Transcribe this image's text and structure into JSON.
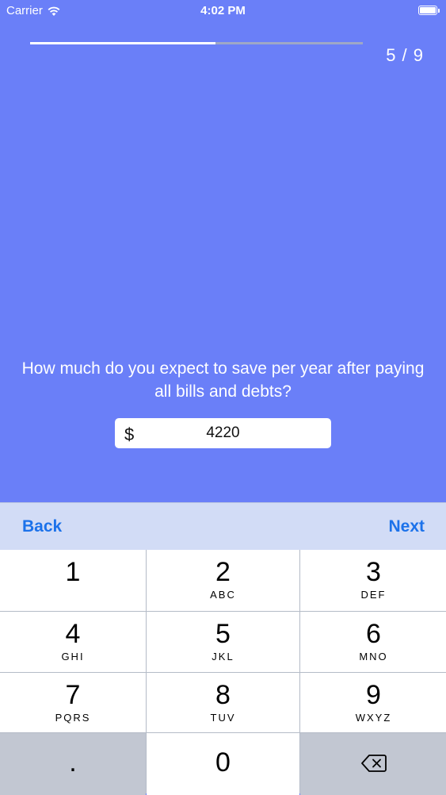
{
  "status_bar": {
    "carrier": "Carrier",
    "time": "4:02 PM",
    "wifi_icon": "wifi-icon",
    "battery_icon": "battery-icon"
  },
  "progress": {
    "current": 5,
    "total": 9,
    "label": "5 / 9",
    "fill_fraction": 0.556
  },
  "question": {
    "text": "How much do you expect to save per year after paying all bills and debts?"
  },
  "amount_field": {
    "currency_symbol": "$",
    "value": "4220"
  },
  "accessory_bar": {
    "back_label": "Back",
    "next_label": "Next"
  },
  "keypad": {
    "keys": [
      {
        "digit": "1",
        "letters": ""
      },
      {
        "digit": "2",
        "letters": "ABC"
      },
      {
        "digit": "3",
        "letters": "DEF"
      },
      {
        "digit": "4",
        "letters": "GHI"
      },
      {
        "digit": "5",
        "letters": "JKL"
      },
      {
        "digit": "6",
        "letters": "MNO"
      },
      {
        "digit": "7",
        "letters": "PQRS"
      },
      {
        "digit": "8",
        "letters": "TUV"
      },
      {
        "digit": "9",
        "letters": "WXYZ"
      }
    ],
    "decimal": ".",
    "zero": "0",
    "backspace_icon": "backspace-icon"
  },
  "colors": {
    "background": "#6a7ff8",
    "accent": "#1c72ea",
    "accessory_bar": "#d2dcf6"
  }
}
